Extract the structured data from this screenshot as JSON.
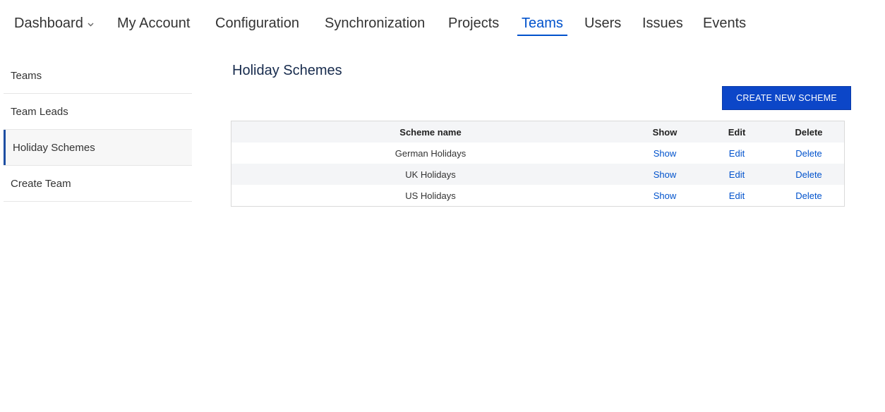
{
  "topnav": {
    "items": [
      {
        "label": "Dashboard",
        "has_dropdown": true
      },
      {
        "label": "My Account"
      },
      {
        "label": "Configuration"
      },
      {
        "label": "Synchronization"
      },
      {
        "label": "Projects"
      },
      {
        "label": "Teams",
        "active": true
      },
      {
        "label": "Users"
      },
      {
        "label": "Issues"
      },
      {
        "label": "Events"
      }
    ]
  },
  "sidebar": {
    "items": [
      {
        "label": "Teams"
      },
      {
        "label": "Team Leads"
      },
      {
        "label": "Holiday Schemes",
        "active": true
      },
      {
        "label": "Create Team"
      }
    ]
  },
  "main": {
    "title": "Holiday Schemes",
    "create_button_label": "CREATE NEW SCHEME",
    "table": {
      "headers": [
        "Scheme name",
        "Show",
        "Edit",
        "Delete"
      ],
      "rows": [
        {
          "name": "German Holidays",
          "show": "Show",
          "edit": "Edit",
          "delete": "Delete"
        },
        {
          "name": "UK Holidays",
          "show": "Show",
          "edit": "Edit",
          "delete": "Delete"
        },
        {
          "name": "US Holidays",
          "show": "Show",
          "edit": "Edit",
          "delete": "Delete"
        }
      ]
    }
  },
  "colors": {
    "accent": "#0052cc",
    "button_bg": "#0c46c8",
    "sidebar_active_bar": "#1e4fa3",
    "stripe": "#f4f5f7"
  }
}
